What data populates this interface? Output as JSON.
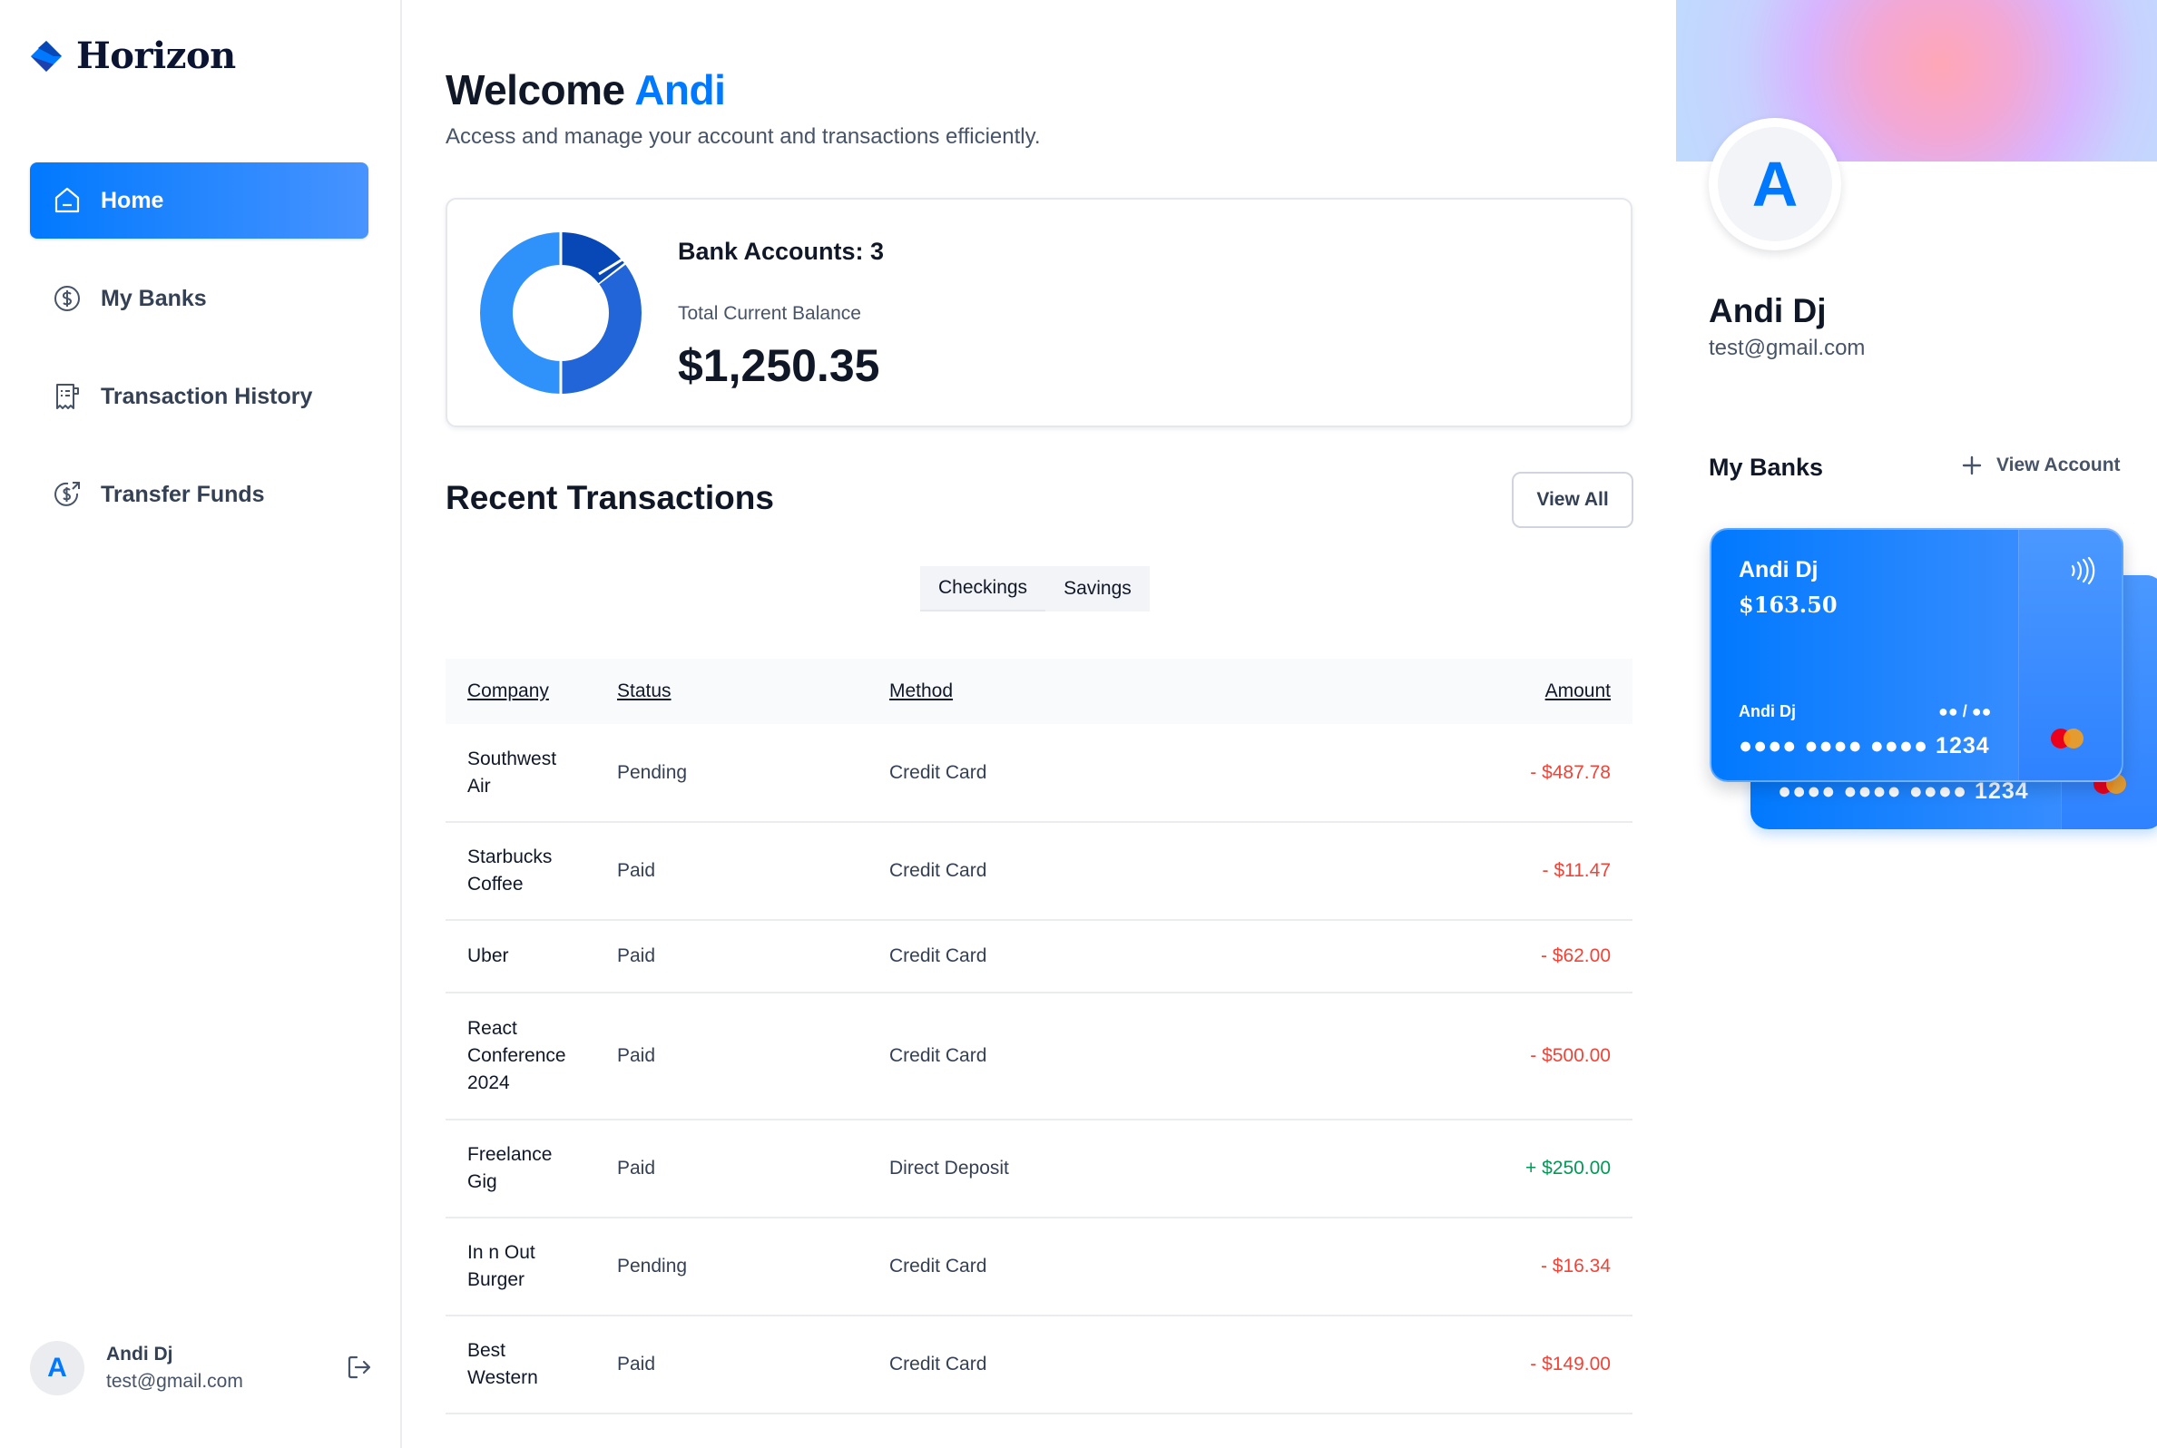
{
  "brand": {
    "name": "Horizon"
  },
  "nav": {
    "items": [
      {
        "label": "Home",
        "icon": "home-icon",
        "active": true
      },
      {
        "label": "My Banks",
        "icon": "dollar-circle-icon"
      },
      {
        "label": "Transaction History",
        "icon": "receipt-icon"
      },
      {
        "label": "Transfer Funds",
        "icon": "money-send-icon"
      }
    ]
  },
  "sidebar_footer": {
    "avatar_letter": "A",
    "name": "Andi Dj",
    "email": "test@gmail.com",
    "logout_icon": "logout-icon"
  },
  "header": {
    "welcome": "Welcome",
    "user": "Andi",
    "subtitle": "Access and manage your account and transactions efficiently."
  },
  "balance": {
    "bank_accounts": "Bank Accounts: 3",
    "total_label": "Total Current Balance",
    "total_value": "$1,250.35",
    "donut_colors": [
      "#0747b6",
      "#2265d8",
      "#2f91fa"
    ]
  },
  "transactions": {
    "title": "Recent Transactions",
    "view_all": "View All",
    "tabs": [
      "Checkings",
      "Savings"
    ],
    "columns": [
      "Company",
      "Status",
      "Method",
      "Amount"
    ],
    "rows": [
      {
        "company": "Southwest Air",
        "status": "Pending",
        "method": "Credit Card",
        "amount": "- $487.78",
        "sign": "neg"
      },
      {
        "company": "Starbucks Coffee",
        "status": "Paid",
        "method": "Credit Card",
        "amount": "- $11.47",
        "sign": "neg"
      },
      {
        "company": "Uber",
        "status": "Paid",
        "method": "Credit Card",
        "amount": "- $62.00",
        "sign": "neg"
      },
      {
        "company": "React Conference 2024",
        "status": "Paid",
        "method": "Credit Card",
        "amount": "- $500.00",
        "sign": "neg"
      },
      {
        "company": "Freelance Gig",
        "status": "Paid",
        "method": "Direct Deposit",
        "amount": "+ $250.00",
        "sign": "pos"
      },
      {
        "company": "In n Out Burger",
        "status": "Pending",
        "method": "Credit Card",
        "amount": "- $16.34",
        "sign": "neg"
      },
      {
        "company": "Best Western",
        "status": "Paid",
        "method": "Credit Card",
        "amount": "- $149.00",
        "sign": "neg"
      }
    ]
  },
  "profile": {
    "avatar_letter": "A",
    "name": "Andi Dj",
    "email": "test@gmail.com"
  },
  "my_banks": {
    "title": "My Banks",
    "view_account": "View Account",
    "card": {
      "name": "Andi Dj",
      "balance": "$163.50",
      "holder": "Andi Dj",
      "expiry": "●● / ●●",
      "number": "●●●● ●●●● ●●●● 1234"
    }
  },
  "colors": {
    "accent": "#0179fe",
    "negative": "#f04438",
    "positive": "#039855"
  }
}
